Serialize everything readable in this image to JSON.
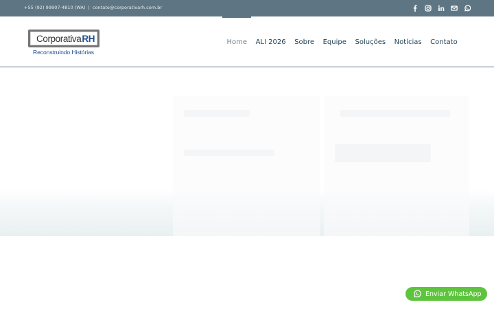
{
  "topbar": {
    "phone": "+55 (92) 99907-4810 (WA)",
    "separator": "|",
    "email": "contato@corporativarh.com.br",
    "social_icons": [
      "facebook-icon",
      "instagram-icon",
      "linkedin-icon",
      "email-icon",
      "whatsapp-icon"
    ]
  },
  "logo": {
    "word": "Corporativa",
    "accent": "RH",
    "tagline": "Reconstruindo Histórias"
  },
  "nav": {
    "items": [
      {
        "label": "Home",
        "active": true
      },
      {
        "label": "ALI 2026"
      },
      {
        "label": "Sobre"
      },
      {
        "label": "Equipe"
      },
      {
        "label": "Soluções"
      },
      {
        "label": "Notícias"
      },
      {
        "label": "Contato"
      }
    ]
  },
  "whatsapp": {
    "label": "Enviar WhatsApp",
    "color": "#5ec43e"
  },
  "colors": {
    "topbar": "#5e7684",
    "nav_text": "#1d3f55",
    "brand_blue": "#1f4e8d"
  }
}
